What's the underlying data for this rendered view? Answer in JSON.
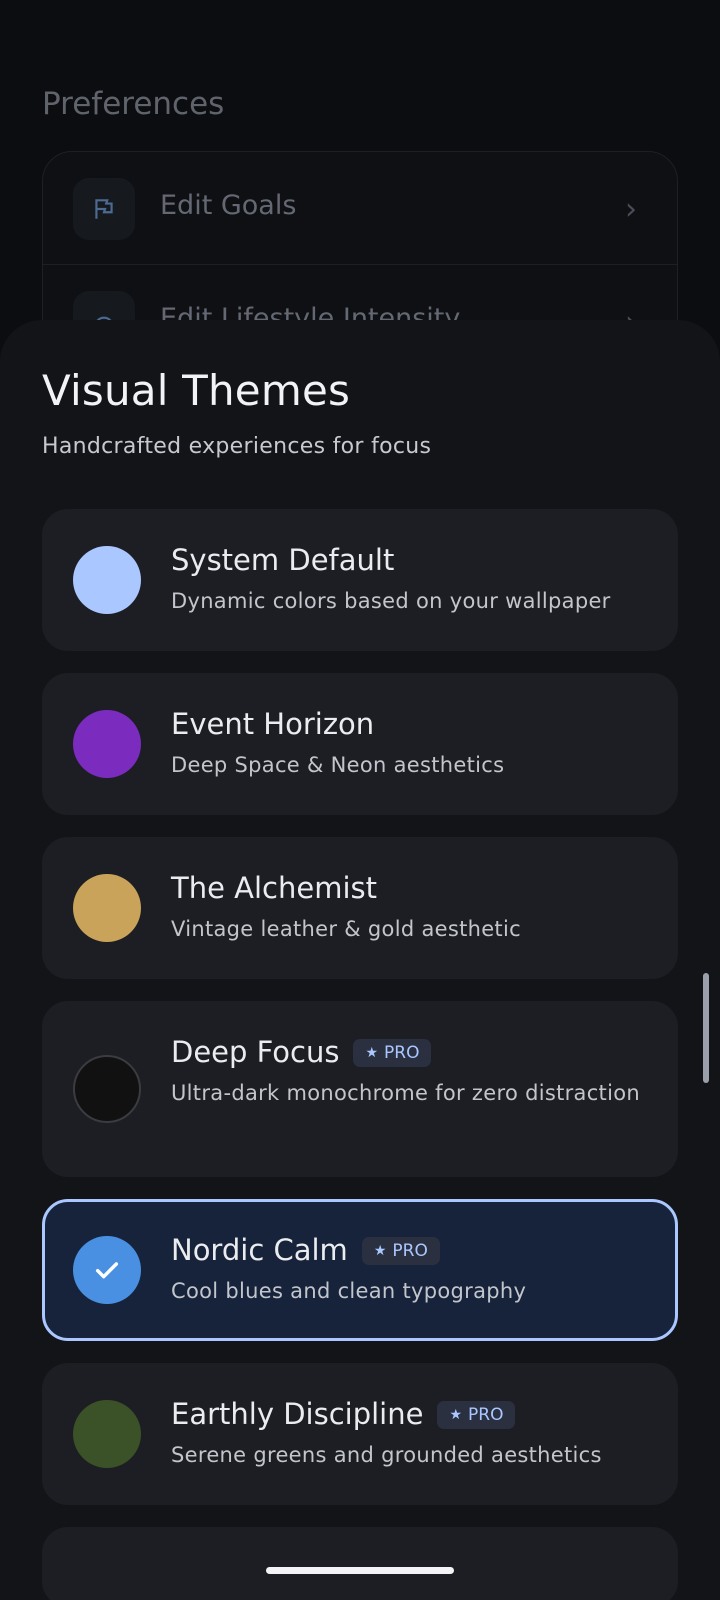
{
  "background": {
    "section_title": "Preferences",
    "items": [
      {
        "label": "Edit Goals",
        "icon": "flag-icon"
      },
      {
        "label": "Edit Lifestyle Intensity",
        "icon": "gauge-icon"
      }
    ]
  },
  "sheet": {
    "title": "Visual Themes",
    "subtitle": "Handcrafted experiences for focus",
    "themes": [
      {
        "name": "System Default",
        "description": "Dynamic colors based on your wallpaper",
        "color": "#aac7ff",
        "pro": false,
        "selected": false
      },
      {
        "name": "Event Horizon",
        "description": "Deep Space & Neon aesthetics",
        "color": "#7b2cbf",
        "pro": false,
        "selected": false
      },
      {
        "name": "The Alchemist",
        "description": "Vintage leather & gold aesthetic",
        "color": "#c9a35a",
        "pro": false,
        "selected": false
      },
      {
        "name": "Deep Focus",
        "description": "Ultra-dark monochrome for zero distraction",
        "color": "#111111",
        "pro": true,
        "selected": false
      },
      {
        "name": "Nordic Calm",
        "description": "Cool blues and clean typography",
        "color": "#4a90e2",
        "pro": true,
        "selected": true
      },
      {
        "name": "Earthly Discipline",
        "description": "Serene greens and grounded aesthetics",
        "color": "#3b5229",
        "pro": true,
        "selected": false
      }
    ],
    "pro_label": "PRO"
  }
}
